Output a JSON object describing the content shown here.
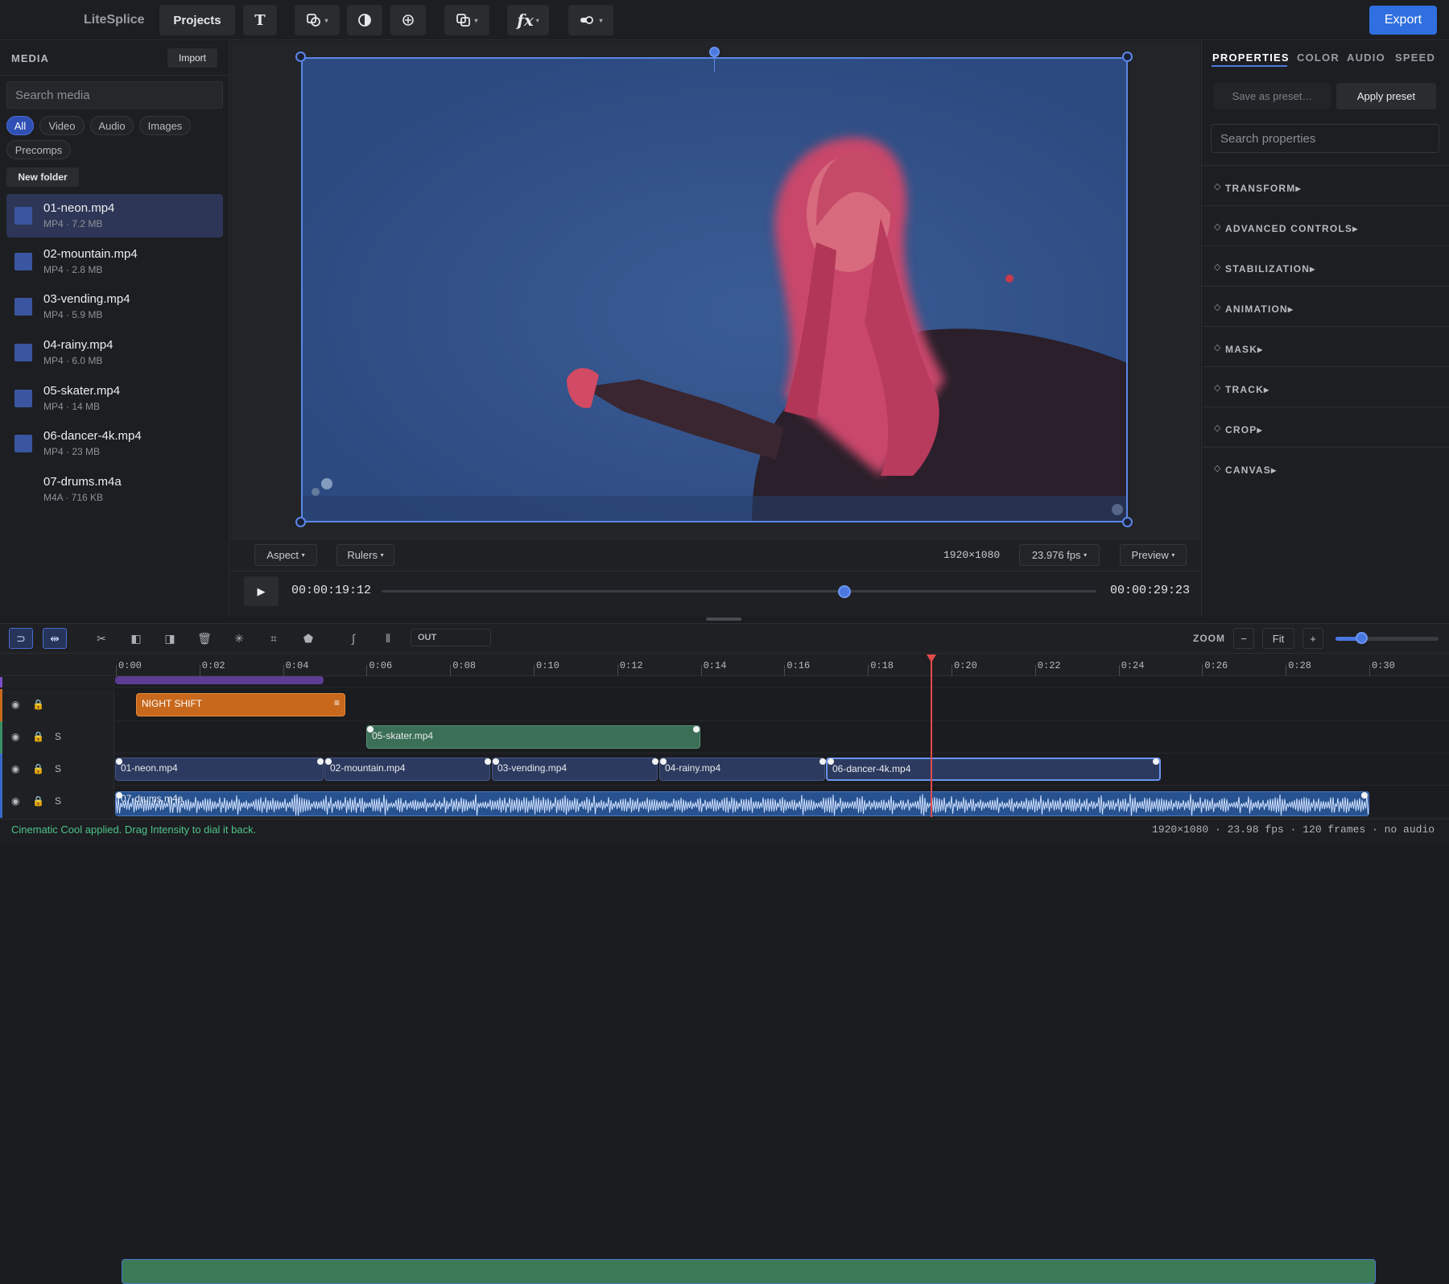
{
  "app": {
    "title": "LiteSplice"
  },
  "toolbar": {
    "projects": "Projects",
    "text_tool": "T",
    "fx_tool": "fx",
    "export": "Export",
    "tools": [
      "shapes-icon",
      "contrast-icon",
      "target-icon",
      "layers-icon",
      "fx-icon",
      "toggle-icon"
    ]
  },
  "media": {
    "header": "MEDIA",
    "import": "Import",
    "search_placeholder": "Search media",
    "filters": [
      "All",
      "Video",
      "Audio",
      "Images",
      "Precomps"
    ],
    "new_folder": "New folder",
    "items": [
      {
        "name": "01-neon.mp4",
        "meta": "MP4 · 7.2 MB",
        "kind": "video"
      },
      {
        "name": "02-mountain.mp4",
        "meta": "MP4 · 2.8 MB",
        "kind": "video"
      },
      {
        "name": "03-vending.mp4",
        "meta": "MP4 · 5.9 MB",
        "kind": "video"
      },
      {
        "name": "04-rainy.mp4",
        "meta": "MP4 · 6.0 MB",
        "kind": "video"
      },
      {
        "name": "05-skater.mp4",
        "meta": "MP4 · 14 MB",
        "kind": "video"
      },
      {
        "name": "06-dancer-4k.mp4",
        "meta": "MP4 · 23 MB",
        "kind": "video"
      },
      {
        "name": "07-drums.m4a",
        "meta": "M4A · 716 KB",
        "kind": "audio"
      }
    ]
  },
  "viewer": {
    "aspect": "Aspect",
    "rulers": "Rulers",
    "resolution": "1920×1080",
    "fps": "23.976 fps",
    "preview": "Preview",
    "current_time": "00:00:19:12",
    "duration": "00:00:29:23",
    "progress": 0.65
  },
  "properties": {
    "tabs": [
      "PROPERTIES",
      "COLOR",
      "AUDIO",
      "SPEED"
    ],
    "save_preset": "Save as preset…",
    "apply_preset": "Apply preset",
    "search_placeholder": "Search properties",
    "sections": [
      "TRANSFORM",
      "ADVANCED CONTROLS",
      "STABILIZATION",
      "ANIMATION",
      "MASK",
      "TRACK",
      "CROP",
      "CANVAS"
    ]
  },
  "timeline": {
    "out_label": "OUT",
    "zoom_label": "ZOOM",
    "zoom_minus": "−",
    "zoom_fit": "Fit",
    "zoom_plus": "+",
    "ruler_ticks": [
      "0:00",
      "0:02",
      "0:04",
      "0:06",
      "0:08",
      "0:10",
      "0:12",
      "0:14",
      "0:16",
      "0:18",
      "0:20",
      "0:22",
      "0:24",
      "0:26",
      "0:28",
      "0:30"
    ],
    "text_clip": "NIGHT SHIFT",
    "overlay_clip": "05-skater.mp4",
    "video_clips": [
      "01-neon.mp4",
      "02-mountain.mp4",
      "03-vending.mp4",
      "04-rainy.mp4",
      "06-dancer-4k.mp4"
    ],
    "audio_clip": "07-drums.m4a",
    "solo": "S"
  },
  "status": {
    "message": "Cinematic Cool applied. Drag Intensity to dial it back.",
    "info": "1920×1080 · 23.98 fps · 120 frames · no audio"
  },
  "colors": {
    "accent": "#2f6fe0",
    "status_ok": "#4ec38a",
    "playhead": "#e24b4b"
  }
}
